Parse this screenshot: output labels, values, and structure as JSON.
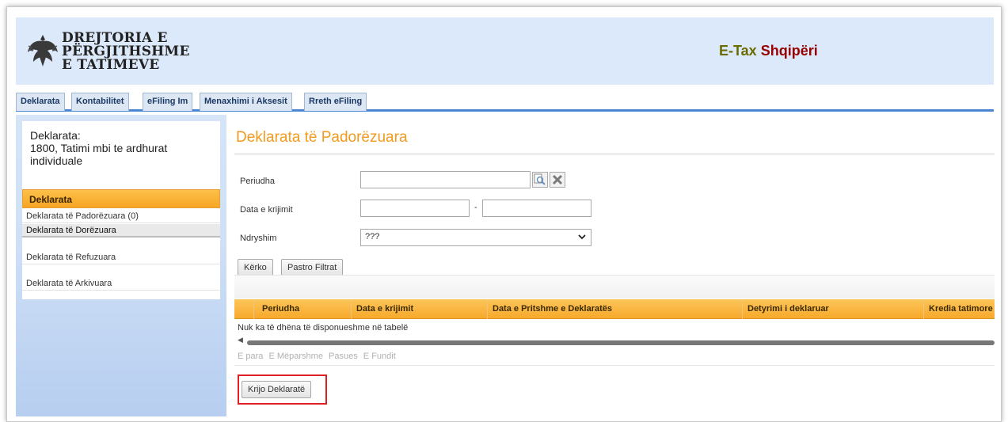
{
  "header": {
    "logo_lines": [
      "DREJTORIA E",
      "PËRGJITHSHME",
      "E TATIMEVE"
    ],
    "brand_part1": "E-Tax",
    "brand_part2": "Shqipëri",
    "brand_color1": "#6b6b00",
    "brand_color2": "#990000",
    "emblem_icon": "eagle-emblem-icon"
  },
  "tabs": [
    {
      "label": "Deklarata"
    },
    {
      "label": "Kontabilitet"
    },
    {
      "label": "eFiling Im"
    },
    {
      "label": "Menaxhimi i Aksesit"
    },
    {
      "label": "Rreth eFiling"
    }
  ],
  "sidebar": {
    "title": "Deklarata:\n1800, Tatimi mbi te ardhurat individuale",
    "title_line1": "Deklarata:",
    "title_line2": "1800, Tatimi mbi te ardhurat",
    "title_line3": "individuale",
    "section_header": "Deklarata",
    "items": [
      {
        "label": "Deklarata të Padorëzuara (0)"
      },
      {
        "label": "Deklarata të Dorëzuara"
      },
      {
        "label": "Deklarata të Refuzuara"
      },
      {
        "label": "Deklarata të Arkivuara"
      }
    ]
  },
  "main": {
    "page_title": "Deklarata të Padorëzuara",
    "accent_color": "#f29a1d",
    "filters": {
      "period_label": "Periudha",
      "period_value": "",
      "date_label": "Data e krijimit",
      "date_from": "",
      "date_sep": "-",
      "date_to": "",
      "change_label": "Ndryshim",
      "change_value": "???"
    },
    "search_button": "Kërko",
    "clear_button": "Pastro Filtrat",
    "grid": {
      "columns": [
        "Periudha",
        "Data e krijimit",
        "Data e Pritshme e Deklaratës",
        "Detyrimi i deklaruar",
        "Kredia tatimore"
      ],
      "empty_message": "Nuk ka të dhëna të disponueshme në tabelë"
    },
    "pager": [
      "E para",
      "E Mëparshme",
      "Pasues",
      "E Fundit"
    ],
    "create_button": "Krijo Deklaratë"
  }
}
